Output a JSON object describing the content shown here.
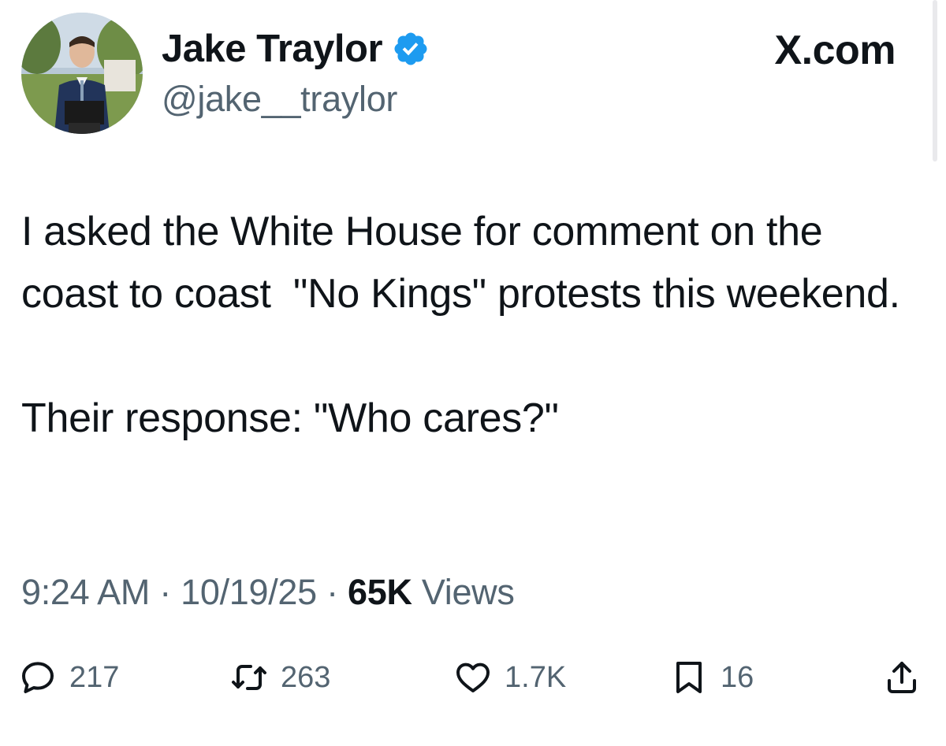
{
  "author": {
    "display_name": "Jake Traylor",
    "handle": "@jake__traylor",
    "verified": true,
    "verified_color": "#1d9bf0"
  },
  "source": "X.com",
  "tweet": {
    "text": "I asked the White House for comment on the coast to coast  \"No Kings\" protests this weekend.\n\nTheir response: \"Who cares?\""
  },
  "meta": {
    "time": "9:24 AM",
    "separator": " · ",
    "date": "10/19/25",
    "views_count": "65K",
    "views_label": " Views"
  },
  "actions": {
    "reply": {
      "icon": "reply-icon",
      "count": "217"
    },
    "retweet": {
      "icon": "retweet-icon",
      "count": "263"
    },
    "like": {
      "icon": "heart-icon",
      "count": "1.7K"
    },
    "bookmark": {
      "icon": "bookmark-icon",
      "count": "16"
    },
    "share": {
      "icon": "share-icon"
    }
  },
  "colors": {
    "text_primary": "#0f1419",
    "text_secondary": "#536471",
    "accent": "#1d9bf0"
  }
}
